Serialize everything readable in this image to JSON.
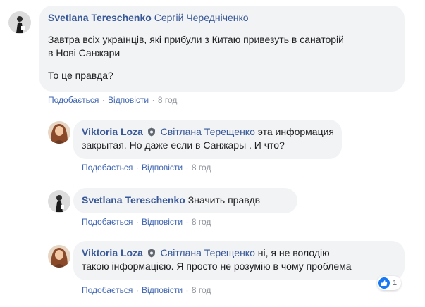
{
  "comments": [
    {
      "author": "Svetlana Tereschenko",
      "mention": "Сергій Чередніченко",
      "body_lines": [
        "Завтра всіх українців, які прибули з Китаю привезуть в санаторій",
        "в Нові Санжари"
      ],
      "question": "То це правда?",
      "like_label": "Подобається",
      "reply_label": "Відповісти",
      "time": "8 год"
    },
    {
      "author": "Viktoria Loza",
      "badge_icon": "shield-icon",
      "mention": "Світлана Терещенко",
      "line1_rest": "эта информация",
      "line2": "закрытая. Но даже если в Санжары . И что?",
      "like_label": "Подобається",
      "reply_label": "Відповісти",
      "time": "8 год"
    },
    {
      "author": "Svetlana Tereschenko",
      "text": "Значить правдв",
      "like_label": "Подобається",
      "reply_label": "Відповісти",
      "time": "8 год"
    },
    {
      "author": "Viktoria Loza",
      "badge_icon": "shield-icon",
      "mention": "Світлана Терещенко",
      "line1_rest": "ні, я не володію",
      "line2": "такою інформацією. Я просто не розумію в чому проблема",
      "like_label": "Подобається",
      "reply_label": "Відповісти",
      "time": "8 год",
      "reaction_icon": "like-icon",
      "reaction_count": "1"
    }
  ],
  "colors": {
    "name": "#385898",
    "link": "#4267b2",
    "meta": "#90949c",
    "bubble": "#f2f3f5",
    "like": "#1877f2"
  }
}
